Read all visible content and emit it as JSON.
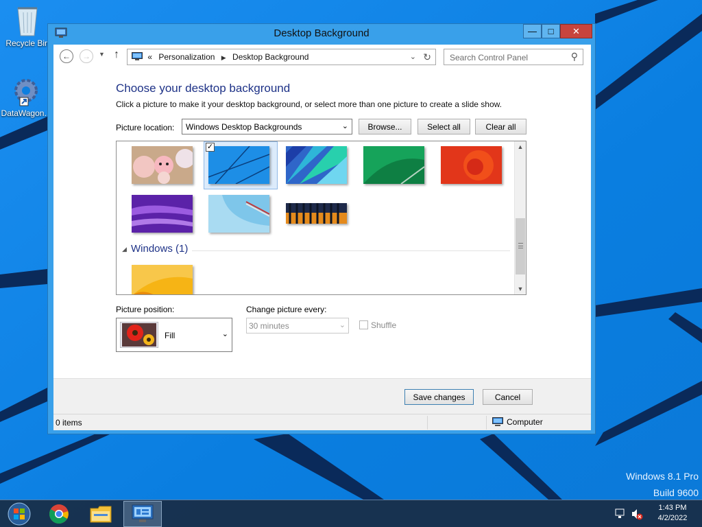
{
  "desktop": {
    "icons": [
      {
        "label": "Recycle Bin",
        "icon": "recycle-bin-icon"
      },
      {
        "label": "DataWagon...",
        "icon": "gear-shortcut-icon"
      }
    ],
    "watermark": {
      "edition": "Windows 8.1 Pro",
      "build": "Build 9600"
    }
  },
  "window": {
    "title": "Desktop Background",
    "controls": {
      "minimize": "—",
      "maximize": "□",
      "close": "✕"
    },
    "address": {
      "prefix": "«",
      "crumbs": [
        "Personalization",
        "Desktop Background"
      ],
      "search_placeholder": "Search Control Panel"
    }
  },
  "page": {
    "heading": "Choose your desktop background",
    "subtext": "Click a picture to make it your desktop background, or select more than one picture to create a slide show.",
    "picture_location_label": "Picture location:",
    "picture_location_value": "Windows Desktop Backgrounds",
    "buttons": {
      "browse": "Browse...",
      "select_all": "Select all",
      "clear_all": "Clear all"
    },
    "gallery": {
      "thumbnails": [
        {
          "name": "cartoon-characters",
          "selected": false
        },
        {
          "name": "blue-lines",
          "selected": true
        },
        {
          "name": "blue-balloon",
          "selected": false
        },
        {
          "name": "green-curve",
          "selected": false
        },
        {
          "name": "red-swirl",
          "selected": false
        },
        {
          "name": "purple-waves",
          "selected": false
        },
        {
          "name": "light-blue-metal",
          "selected": false
        },
        {
          "name": "orange-bars",
          "selected": false
        }
      ],
      "group_label": "Windows (1)",
      "group_thumbnails": [
        {
          "name": "yellow-orange",
          "selected": false
        }
      ]
    },
    "picture_position_label": "Picture position:",
    "picture_position_value": "Fill",
    "change_picture_label": "Change picture every:",
    "change_picture_value": "30 minutes",
    "shuffle_label": "Shuffle",
    "shuffle_checked": false
  },
  "footer": {
    "save": "Save changes",
    "cancel": "Cancel"
  },
  "status": {
    "items": "0 items",
    "location": "Computer"
  },
  "taskbar": {
    "apps": [
      "start-button",
      "chrome-icon",
      "file-explorer-icon",
      "control-panel-icon"
    ],
    "active_app": "control-panel-icon",
    "time": "1:43 PM",
    "date": "4/2/2022"
  },
  "colors": {
    "accent": "#1e3287",
    "titlebar": "#39a0ea",
    "close": "#c8443d",
    "desktop": "#0d7fe0"
  }
}
